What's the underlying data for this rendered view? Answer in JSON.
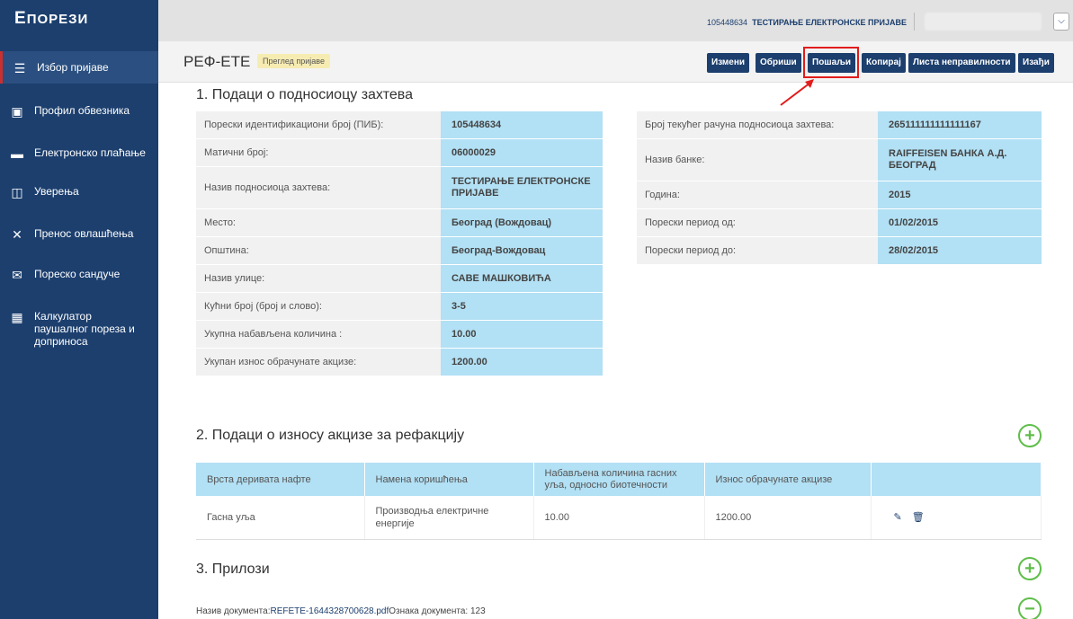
{
  "logo": {
    "text_e": "Е",
    "text_main": "ПОРЕЗИ"
  },
  "sidebar": {
    "items": [
      {
        "label": "Избор пријаве",
        "icon": "list-icon"
      },
      {
        "label": "Профил обвезника",
        "icon": "user-icon"
      },
      {
        "label": "Електронско плаћање",
        "icon": "card-icon"
      },
      {
        "label": "Уверења",
        "icon": "certificate-icon"
      },
      {
        "label": "Пренос овлашћења",
        "icon": "transfer-icon"
      },
      {
        "label": "Пореско сандуче",
        "icon": "mail-icon"
      },
      {
        "label": "Калкулатор паушалног пореза и доприноса",
        "icon": "calculator-icon"
      }
    ]
  },
  "topbar": {
    "pib": "105448634",
    "name": "ТЕСТИРАЊЕ ЕЛЕКТРОНСКЕ ПРИЈАВЕ"
  },
  "header": {
    "title": "РЕФ-ЕТЕ",
    "badge": "Преглед пријаве",
    "buttons": {
      "edit": "Измени",
      "delete": "Обриши",
      "send": "Пошаљи",
      "copy": "Копирај",
      "errors": "Листа неправилности",
      "exit": "Изађи"
    }
  },
  "section1": {
    "title": "1. Подаци о подносиоцу захтева",
    "left": [
      {
        "label": "Порески идентификациони број (ПИБ):",
        "value": "105448634"
      },
      {
        "label": "Матични број:",
        "value": "06000029"
      },
      {
        "label": "Назив подносиоца захтева:",
        "value": "ТЕСТИРАЊЕ ЕЛЕКТРОНСКЕ ПРИЈАВЕ"
      },
      {
        "label": "Место:",
        "value": "Београд (Вождовац)"
      },
      {
        "label": "Општина:",
        "value": "Београд-Вождовац"
      },
      {
        "label": "Назив улице:",
        "value": "САВЕ МАШКОВИЋА"
      },
      {
        "label": "Кућни број (број и слово):",
        "value": "3-5"
      },
      {
        "label": "Укупна набављена количина :",
        "value": "10.00"
      },
      {
        "label": "Укупан износ обрачунате акцизе:",
        "value": "1200.00"
      }
    ],
    "right": [
      {
        "label": "Број текућег рачуна подносиоца захтева:",
        "value": "265111111111111167"
      },
      {
        "label": "Назив банке:",
        "value": "RAIFFEISEN БАНКА А.Д. БЕОГРАД"
      },
      {
        "label": "Година:",
        "value": "2015"
      },
      {
        "label": "Порески период од:",
        "value": "01/02/2015"
      },
      {
        "label": "Порески период до:",
        "value": "28/02/2015"
      }
    ]
  },
  "section2": {
    "title": "2. Подаци о износу акцизе за рефакцију",
    "columns": [
      "Врста деривата нафте",
      "Намена коришћења",
      "Набављена количина гасних уља, односно биотечности",
      "Износ обрачунате акцизе",
      ""
    ],
    "rows": [
      [
        "Гасна уља",
        "Производња електричне енергије",
        "10.00",
        "1200.00"
      ]
    ]
  },
  "section3": {
    "title": "3. Прилози",
    "doc_label": "Назив документа:",
    "doc_name": "REFETE-1644328700628.pdf",
    "doc_mark": "Ознака документа: 123"
  },
  "colors": {
    "sidebar": "#1c3f6e",
    "accent": "#b2e0f4",
    "highlight": "#e21c1c",
    "plus": "#5fbe4a"
  }
}
